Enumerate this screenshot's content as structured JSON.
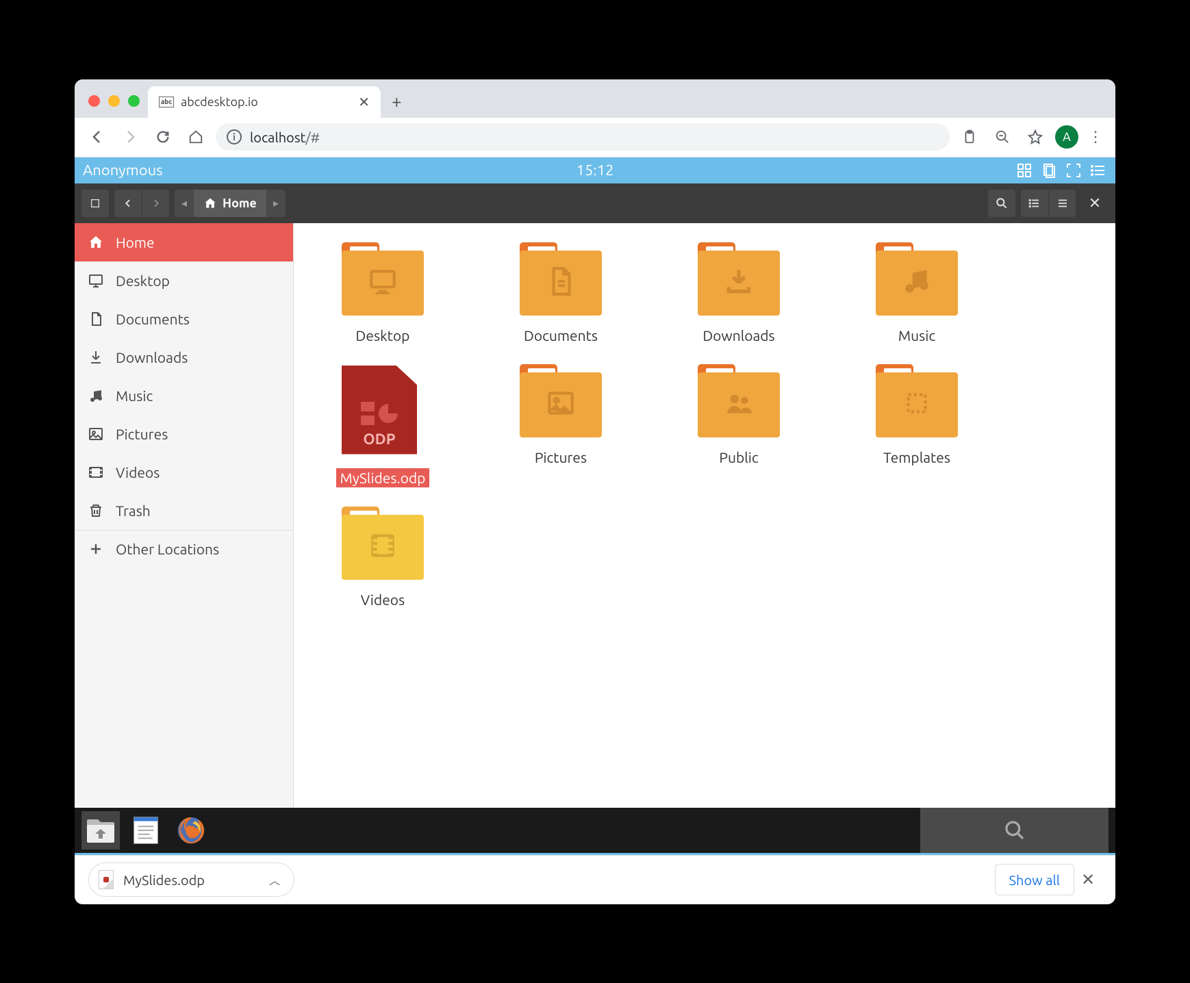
{
  "browser": {
    "tab_title": "abcdesktop.io",
    "url_host": "localhost",
    "url_path": "/#",
    "avatar_letter": "A"
  },
  "deskbar": {
    "user": "Anonymous",
    "time": "15:12"
  },
  "fm": {
    "path_label": "Home",
    "sidebar": [
      {
        "id": "home",
        "label": "Home",
        "icon": "home",
        "active": true
      },
      {
        "id": "desktop",
        "label": "Desktop",
        "icon": "monitor"
      },
      {
        "id": "documents",
        "label": "Documents",
        "icon": "doc"
      },
      {
        "id": "downloads",
        "label": "Downloads",
        "icon": "download"
      },
      {
        "id": "music",
        "label": "Music",
        "icon": "music"
      },
      {
        "id": "pictures",
        "label": "Pictures",
        "icon": "picture"
      },
      {
        "id": "videos",
        "label": "Videos",
        "icon": "video"
      },
      {
        "id": "trash",
        "label": "Trash",
        "icon": "trash"
      },
      {
        "id": "other",
        "label": "Other Locations",
        "icon": "plus",
        "divider": true
      }
    ],
    "files": [
      {
        "name": "Desktop",
        "type": "folder",
        "glyph": "monitor"
      },
      {
        "name": "Documents",
        "type": "folder",
        "glyph": "doc"
      },
      {
        "name": "Downloads",
        "type": "folder",
        "glyph": "download"
      },
      {
        "name": "Music",
        "type": "folder",
        "glyph": "music"
      },
      {
        "name": "MySlides.odp",
        "type": "odp",
        "selected": true,
        "odp_label": "ODP"
      },
      {
        "name": "Pictures",
        "type": "folder",
        "glyph": "picture"
      },
      {
        "name": "Public",
        "type": "folder",
        "glyph": "people"
      },
      {
        "name": "Templates",
        "type": "folder",
        "glyph": "template"
      },
      {
        "name": "Videos",
        "type": "folder-videos",
        "glyph": "film"
      }
    ]
  },
  "download": {
    "filename": "MySlides.odp",
    "show_all": "Show all"
  }
}
